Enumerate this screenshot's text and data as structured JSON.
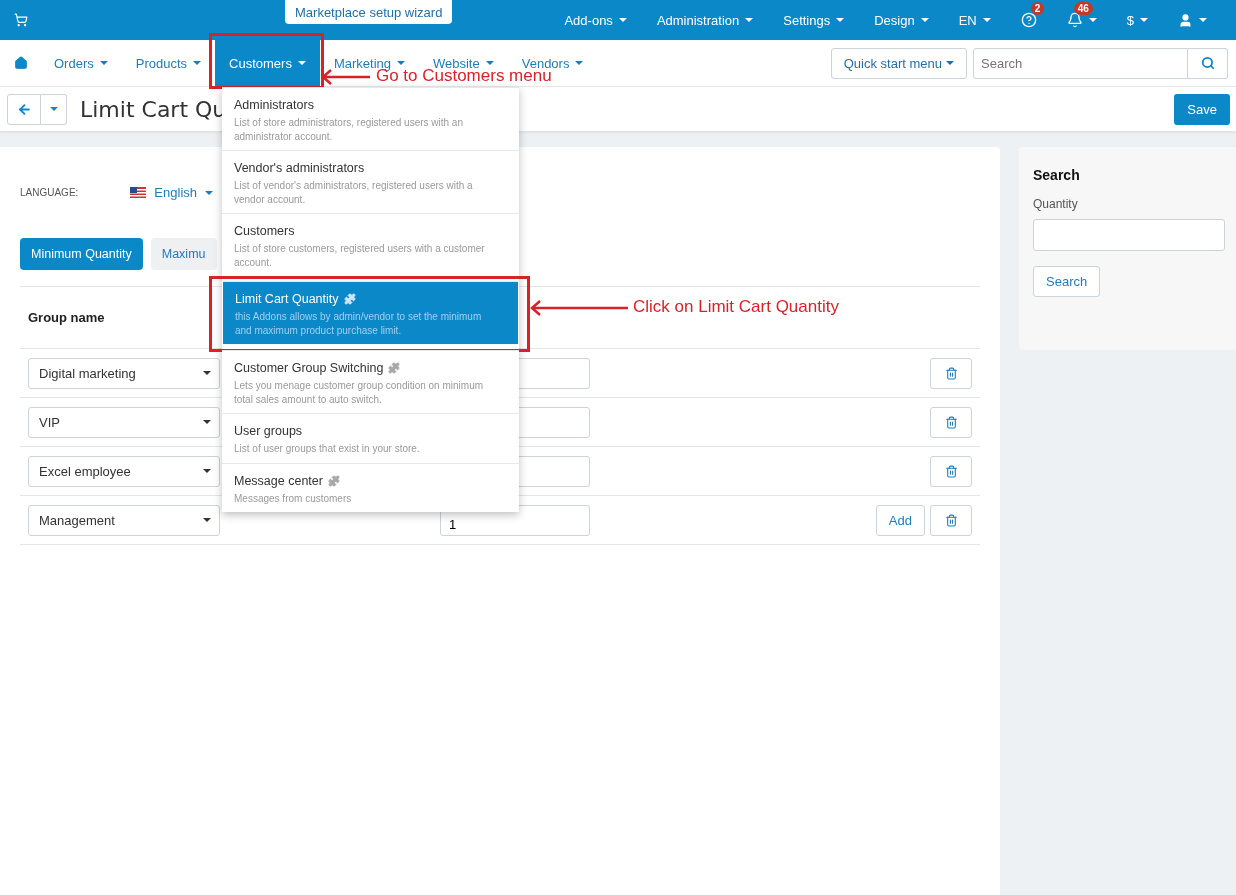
{
  "top_bar": {
    "wizard_button": "Marketplace setup wizard",
    "menus": [
      {
        "label": "Add-ons"
      },
      {
        "label": "Administration"
      },
      {
        "label": "Settings"
      },
      {
        "label": "Design"
      },
      {
        "label": "EN"
      }
    ],
    "help_badge": "2",
    "notification_badge": "46",
    "currency": "$"
  },
  "nav": {
    "items": [
      {
        "label": "Orders",
        "selected": false
      },
      {
        "label": "Products",
        "selected": false
      },
      {
        "label": "Customers",
        "selected": true
      },
      {
        "label": "Marketing",
        "selected": false
      },
      {
        "label": "Website",
        "selected": false
      },
      {
        "label": "Vendors",
        "selected": false
      }
    ],
    "quick_start": "Quick start menu",
    "search": {
      "placeholder": "Search"
    }
  },
  "title_bar": {
    "title": "Limit Cart Qu",
    "save": "Save"
  },
  "language": {
    "label": "LANGUAGE:",
    "value": "English"
  },
  "tabs": [
    {
      "label": "Minimum Quantity",
      "selected": true
    },
    {
      "label": "Maximu",
      "selected": false
    }
  ],
  "table": {
    "columns": [
      "Group name"
    ],
    "rows": [
      {
        "group": "Digital marketing"
      },
      {
        "group": "VIP"
      },
      {
        "group": "Excel employee"
      },
      {
        "group": "Management",
        "quantity": "1",
        "add": "Add"
      }
    ]
  },
  "dropdown": {
    "items": [
      {
        "title": "Administrators",
        "description": "List of store administrators, registered users with an administrator account.",
        "addon": false,
        "selected": false
      },
      {
        "title": "Vendor's administrators",
        "description": "List of vendor's administrators, registered users with a vendor account.",
        "addon": false,
        "selected": false
      },
      {
        "title": "Customers",
        "description": "List of store customers, registered users with a customer account.",
        "addon": false,
        "selected": false
      },
      {
        "title": "Limit Cart Quantity",
        "description": "this Addons allows by admin/vendor to set the minimum and maximum product purchase limit.",
        "addon": true,
        "selected": true
      },
      {
        "title": "Customer Group Switching",
        "description": "Lets you menage customer group condition on minimum total sales amount to auto switch.",
        "addon": true,
        "selected": false
      },
      {
        "title": "User groups",
        "description": "List of user groups that exist in your store.",
        "addon": false,
        "selected": false
      },
      {
        "title": "Message center",
        "description": "Messages from customers",
        "addon": true,
        "selected": false
      }
    ]
  },
  "sidebar": {
    "title": "Search",
    "field_label": "Quantity",
    "button": "Search"
  },
  "annotations": [
    {
      "text": "Go to Customers menu"
    },
    {
      "text": "Click on Limit Cart Quantity"
    }
  ]
}
